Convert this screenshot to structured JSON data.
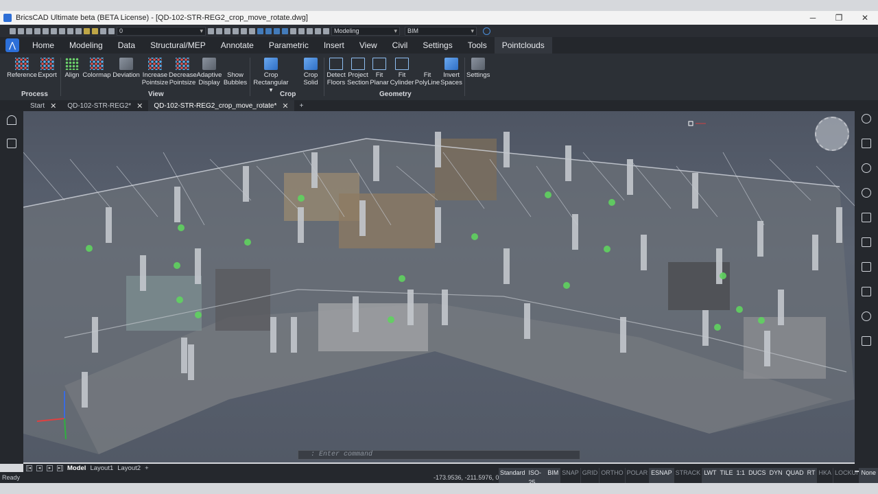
{
  "window": {
    "title": "BricsCAD Ultimate beta (BETA License) - [QD-102-STR-REG2_crop_move_rotate.dwg]",
    "minimize": "─",
    "maximize": "❐",
    "close": "✕"
  },
  "qat": {
    "layer_value": "0",
    "workspace": "Modeling",
    "profile": "BIM"
  },
  "ribbon_tabs": [
    "Home",
    "Modeling",
    "Data",
    "Structural/MEP",
    "Annotate",
    "Parametric",
    "Insert",
    "View",
    "Civil",
    "Settings",
    "Tools",
    "Pointclouds"
  ],
  "ribbon": {
    "process": {
      "group": "Process",
      "reference": "Reference",
      "export": "Export"
    },
    "view": {
      "group": "View",
      "align": "Align",
      "colormap": "Colormap",
      "deviation": "Deviation",
      "increase1": "Increase",
      "increase2": "Pointsize",
      "decrease1": "Decrease",
      "decrease2": "Pointsize",
      "adaptive1": "Adaptive",
      "adaptive2": "Display",
      "show1": "Show",
      "show2": "Bubbles"
    },
    "crop": {
      "group": "Crop",
      "rect1": "Crop",
      "rect2": "Rectangular ▾",
      "solid1": "Crop",
      "solid2": "Solid"
    },
    "geometry": {
      "group": "Geometry",
      "detect1": "Detect",
      "detect2": "Floors",
      "project1": "Project",
      "project2": "Section",
      "fitplanar1": "Fit",
      "fitplanar2": "Planar",
      "fitcyl1": "Fit",
      "fitcyl2": "Cylinder",
      "fitpoly1": "Fit",
      "fitpoly2": "PolyLine",
      "invert1": "Invert",
      "invert2": "Spaces"
    },
    "settings": {
      "label": "Settings"
    }
  },
  "doc_tabs": {
    "start": "Start",
    "doc1": "QD-102-STR-REG2*",
    "doc2": "QD-102-STR-REG2_crop_move_rotate*",
    "add": "+"
  },
  "command_line": {
    "placeholder": ": Enter command"
  },
  "layout_tabs": {
    "model": "Model",
    "layout1": "Layout1",
    "layout2": "Layout2",
    "add": "+"
  },
  "status": {
    "ready": "Ready",
    "coords": "-173.9536, -211.5976, 0",
    "toggles": [
      "Standard",
      "ISO-25",
      "BIM",
      "SNAP",
      "GRID",
      "ORTHO",
      "POLAR",
      "ESNAP",
      "STRACK",
      "LWT",
      "TILE",
      "1:1",
      "DUCS",
      "DYN",
      "QUAD",
      "RT",
      "HKA",
      "LOCKUI",
      "None"
    ],
    "toggles_on": [
      "Standard",
      "ISO-25",
      "BIM",
      "ESNAP",
      "LWT",
      "TILE",
      "1:1",
      "DUCS",
      "DYN",
      "QUAD",
      "RT",
      "None"
    ]
  },
  "colors": {
    "accent": "#2c6fd8",
    "viewport_bg": "#555c69",
    "bubble": "#5fd35f"
  }
}
